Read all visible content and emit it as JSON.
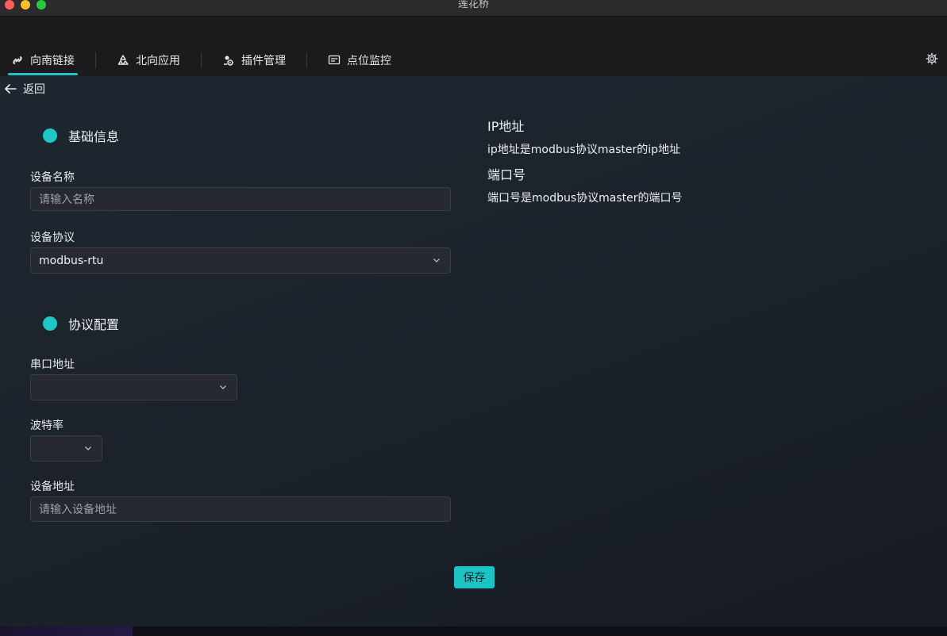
{
  "window": {
    "title": "莲花桥"
  },
  "tabs": [
    {
      "label": "向南链接",
      "icon": "link-icon",
      "active": true
    },
    {
      "label": "北向应用",
      "icon": "recycle-icon",
      "active": false
    },
    {
      "label": "插件管理",
      "icon": "plugin-gear-icon",
      "active": false
    },
    {
      "label": "点位监控",
      "icon": "monitor-icon",
      "active": false
    }
  ],
  "nav": {
    "back_label": "返回"
  },
  "basic": {
    "section_title": "基础信息",
    "device_name_label": "设备名称",
    "device_name_placeholder": "请输入名称",
    "device_protocol_label": "设备协议",
    "device_protocol_value": "modbus-rtu"
  },
  "protocol": {
    "section_title": "协议配置",
    "serial_port_label": "串口地址",
    "serial_port_value": "",
    "baud_rate_label": "波特率",
    "baud_rate_value": "",
    "device_address_label": "设备地址",
    "device_address_placeholder": "请输入设备地址"
  },
  "help": {
    "ip_title": "IP地址",
    "ip_text": "ip地址是modbus协议master的ip地址",
    "port_title": "端口号",
    "port_text": "端口号是modbus协议master的端口号"
  },
  "actions": {
    "save_label": "保存"
  },
  "colors": {
    "accent": "#1fc6c6",
    "background": "#1a2129"
  }
}
